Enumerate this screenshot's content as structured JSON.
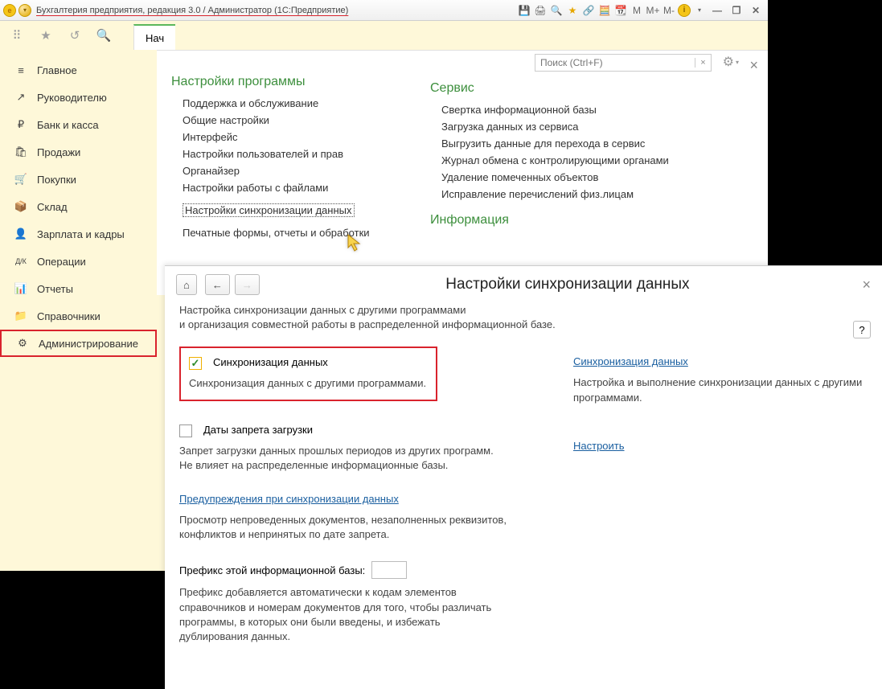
{
  "title": "Бухгалтерия предприятия, редакция 3.0 / Администратор  (1С:Предприятие)",
  "toolbar_m": [
    "M",
    "M+",
    "M-"
  ],
  "tab_label": "Нач",
  "sidebar": {
    "items": [
      {
        "label": "Главное",
        "icon": "≡"
      },
      {
        "label": "Руководителю",
        "icon": "↗"
      },
      {
        "label": "Банк и касса",
        "icon": "₽"
      },
      {
        "label": "Продажи",
        "icon": "🛍"
      },
      {
        "label": "Покупки",
        "icon": "🛒"
      },
      {
        "label": "Склад",
        "icon": "📦"
      },
      {
        "label": "Зарплата и кадры",
        "icon": "👤"
      },
      {
        "label": "Операции",
        "icon": "Д/К"
      },
      {
        "label": "Отчеты",
        "icon": "📊"
      },
      {
        "label": "Справочники",
        "icon": "📁"
      },
      {
        "label": "Администрирование",
        "icon": "⚙"
      }
    ]
  },
  "search_placeholder": "Поиск (Ctrl+F)",
  "settings_page": {
    "section1_title": "Настройки программы",
    "section1_items": [
      "Поддержка и обслуживание",
      "Общие настройки",
      "Интерфейс",
      "Настройки пользователей и прав",
      "Органайзер",
      "Настройки работы с файлами",
      "Настройки синхронизации данных",
      "Печатные формы, отчеты и обработки"
    ],
    "section2_title": "Сервис",
    "section2_items": [
      "Свертка информационной базы",
      "Загрузка данных из сервиса",
      "Выгрузить данные для перехода в сервис",
      "Журнал обмена с контролирующими органами",
      "Удаление помеченных объектов",
      "Исправление перечислений физ.лицам"
    ],
    "section3_title": "Информация"
  },
  "sync_panel": {
    "title": "Настройки синхронизации данных",
    "description_l1": "Настройка синхронизации данных с другими программами",
    "description_l2": "и организация совместной работы в распределенной информационной базе.",
    "help": "?",
    "sync_checkbox_label": "Синхронизация данных",
    "sync_checkbox_desc": "Синхронизация данных с другими программами.",
    "sync_link": "Синхронизация данных",
    "sync_link_desc": "Настройка и выполнение синхронизации данных с другими программами.",
    "block_dates_label": "Даты запрета загрузки",
    "block_dates_desc": "Запрет загрузки данных прошлых периодов из других программ.\nНе влияет на распределенные информационные базы.",
    "configure_link": "Настроить",
    "warnings_link": "Предупреждения при синхронизации данных",
    "warnings_desc": "Просмотр непроведенных документов, незаполненных реквизитов, конфликтов и непринятых по дате запрета.",
    "prefix_label": "Префикс этой информационной базы:",
    "prefix_desc": "Префикс добавляется автоматически к кодам элементов справочников и номерам документов для того, чтобы различать программы, в которых они были введены, и избежать дублирования данных."
  }
}
